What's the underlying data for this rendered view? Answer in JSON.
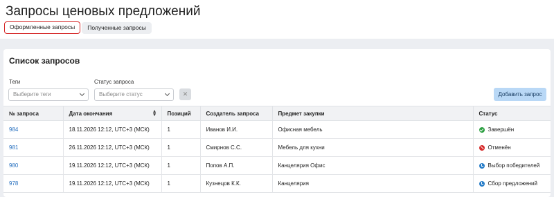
{
  "page": {
    "title": "Запросы ценовых предложений"
  },
  "tabs": [
    {
      "label": "Оформленные запросы",
      "active": true
    },
    {
      "label": "Полученные запросы",
      "active": false
    }
  ],
  "card": {
    "title": "Список запросов"
  },
  "filters": {
    "tags": {
      "label": "Теги",
      "placeholder": "Выберите теги"
    },
    "status": {
      "label": "Статус запроса",
      "placeholder": "Выберите статус"
    },
    "clear_icon": "close-icon"
  },
  "add_button": {
    "label": "Добавить запрос"
  },
  "table": {
    "headers": [
      "№ запроса",
      "Дата окончания",
      "Позиций",
      "Создатель запроса",
      "Предмет закупки",
      "Статус"
    ],
    "rows": [
      {
        "id": "984",
        "date": "18.11.2026 12:12, UTC+3 (МСК)",
        "positions": "1",
        "creator": "Иванов И.И.",
        "subject": "Офисная мебель",
        "status": "Завершён",
        "status_type": "ok"
      },
      {
        "id": "981",
        "date": "26.11.2026 12:12, UTC+3 (МСК)",
        "positions": "1",
        "creator": "Смирнов С.С.",
        "subject": "Мебель для кухни",
        "status": "Отменён",
        "status_type": "cancel"
      },
      {
        "id": "980",
        "date": "19.11.2026 12:12, UTC+3 (МСК)",
        "positions": "1",
        "creator": "Попов А.П.",
        "subject": "Канцелярия Офис",
        "status": "Выбор победителей",
        "status_type": "progress"
      },
      {
        "id": "978",
        "date": "19.11.2026 12:12, UTC+3 (МСК)",
        "positions": "1",
        "creator": "Кузнецов К.К.",
        "subject": "Канцелярия",
        "status": "Сбор предложений",
        "status_type": "progress"
      }
    ]
  },
  "colors": {
    "accent": "#2a72c0",
    "active_tab_border": "#d62b2b",
    "add_button_bg": "#b9d8f6"
  }
}
